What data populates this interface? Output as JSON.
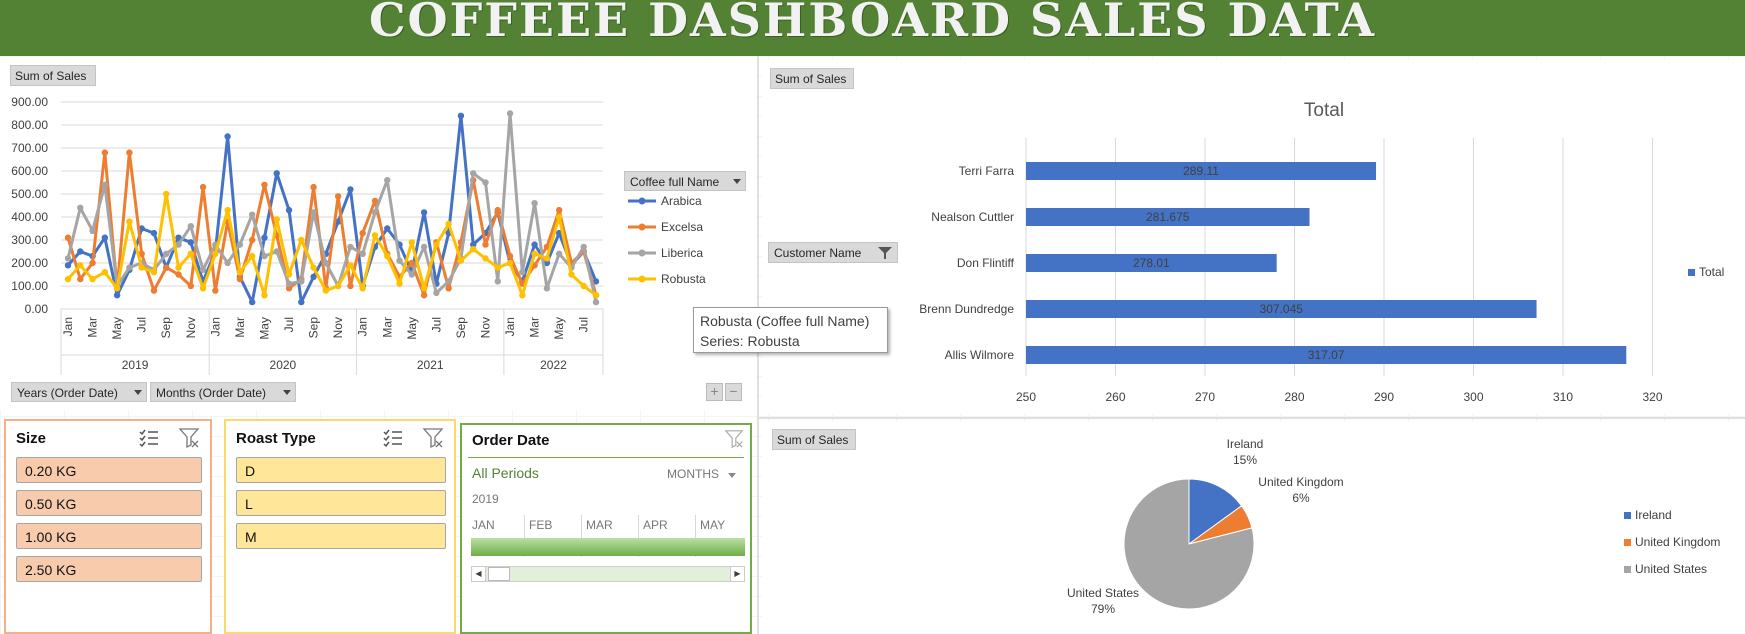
{
  "title": "COFFEEE DASHBOARD SALES DATA",
  "line_panel": {
    "field_button": "Sum of Sales",
    "legend_header": "Coffee full Name",
    "years_dropdown": "Years (Order Date)",
    "months_dropdown": "Months (Order Date)",
    "plus_label": "+",
    "minus_label": "−"
  },
  "tooltip": {
    "line1": "Robusta (Coffee full Name)",
    "line2": "Series: Robusta"
  },
  "bar_panel": {
    "field_button": "Sum of Sales",
    "customer_button": "Customer Name",
    "legend": "Total"
  },
  "pie_panel": {
    "field_button": "Sum of Sales"
  },
  "slicers": {
    "size": {
      "title": "Size",
      "items": [
        "0.20 KG",
        "0.50 KG",
        "1.00 KG",
        "2.50 KG"
      ]
    },
    "roast": {
      "title": "Roast Type",
      "items": [
        "D",
        "L",
        "M"
      ]
    },
    "order_date": {
      "title": "Order Date",
      "all_periods": "All Periods",
      "level": "MONTHS",
      "year": "2019",
      "months": [
        "JAN",
        "FEB",
        "MAR",
        "APR",
        "MAY"
      ]
    }
  },
  "colors": {
    "arabica": "#4472c4",
    "excelsa": "#ed7d31",
    "liberica": "#a5a5a5",
    "robusta": "#ffc000",
    "bar": "#4472c4",
    "header": "#548235"
  },
  "chart_data": [
    {
      "type": "line",
      "yticks": [
        "900.00",
        "800.00",
        "700.00",
        "600.00",
        "500.00",
        "400.00",
        "300.00",
        "200.00",
        "100.00",
        "0.00"
      ],
      "ylim": [
        0,
        900
      ],
      "month_labels": [
        "Jan",
        "Mar",
        "May",
        "Jul",
        "Sep",
        "Nov",
        "Jan",
        "Mar",
        "May",
        "Jul",
        "Sep",
        "Nov",
        "Jan",
        "Mar",
        "May",
        "Jul",
        "Sep",
        "Nov",
        "Jan",
        "Mar",
        "May",
        "Jul"
      ],
      "years": [
        "2019",
        "2020",
        "2021",
        "2022"
      ],
      "n_points": 44,
      "series": [
        {
          "name": "Arabica",
          "color": "#4472c4",
          "values": [
            190,
            250,
            230,
            310,
            60,
            170,
            350,
            330,
            180,
            310,
            290,
            120,
            250,
            750,
            140,
            30,
            310,
            590,
            430,
            30,
            140,
            240,
            380,
            520,
            100,
            270,
            350,
            280,
            160,
            420,
            110,
            330,
            840,
            280,
            330,
            420,
            200,
            120,
            280,
            200,
            330,
            190,
            250,
            120
          ]
        },
        {
          "name": "Excelsa",
          "color": "#ed7d31",
          "values": [
            310,
            130,
            200,
            680,
            90,
            680,
            240,
            80,
            180,
            150,
            100,
            530,
            80,
            380,
            130,
            300,
            540,
            320,
            90,
            130,
            530,
            90,
            490,
            100,
            330,
            470,
            240,
            140,
            200,
            60,
            290,
            90,
            290,
            560,
            280,
            430,
            230,
            110,
            190,
            270,
            430,
            200,
            250,
            60
          ]
        },
        {
          "name": "Liberica",
          "color": "#a5a5a5",
          "values": [
            220,
            440,
            340,
            540,
            100,
            180,
            200,
            170,
            240,
            280,
            360,
            170,
            280,
            200,
            280,
            410,
            230,
            250,
            110,
            120,
            420,
            200,
            100,
            270,
            240,
            420,
            560,
            210,
            150,
            270,
            70,
            120,
            220,
            590,
            550,
            120,
            850,
            160,
            460,
            90,
            240,
            180,
            270,
            30
          ]
        },
        {
          "name": "Robusta",
          "color": "#ffc000",
          "values": [
            130,
            190,
            130,
            160,
            90,
            380,
            180,
            160,
            500,
            180,
            240,
            90,
            240,
            430,
            160,
            230,
            60,
            390,
            150,
            300,
            180,
            80,
            100,
            190,
            90,
            320,
            230,
            110,
            290,
            90,
            280,
            370,
            210,
            260,
            220,
            180,
            200,
            60,
            240,
            220,
            400,
            150,
            100,
            60
          ]
        }
      ]
    },
    {
      "type": "bar",
      "title": "Total",
      "categories": [
        "Terri Farra",
        "Nealson Cuttler",
        "Don Flintiff",
        "Brenn Dundredge",
        "Allis Wilmore"
      ],
      "values": [
        289.11,
        281.675,
        278.01,
        307.045,
        317.07
      ],
      "value_labels": [
        "289.11",
        "281.675",
        "278.01",
        "307.045",
        "317.07"
      ],
      "xticks": [
        "250",
        "260",
        "270",
        "280",
        "290",
        "300",
        "310",
        "320"
      ],
      "xlim": [
        250,
        325
      ],
      "legend": "Total"
    },
    {
      "type": "pie",
      "slices": [
        {
          "name": "Ireland",
          "value": 15,
          "label": "15%",
          "color": "#4472c4"
        },
        {
          "name": "United Kingdom",
          "value": 6,
          "label": "6%",
          "color": "#ed7d31"
        },
        {
          "name": "United States",
          "value": 79,
          "label": "79%",
          "color": "#a5a5a5"
        }
      ]
    }
  ]
}
